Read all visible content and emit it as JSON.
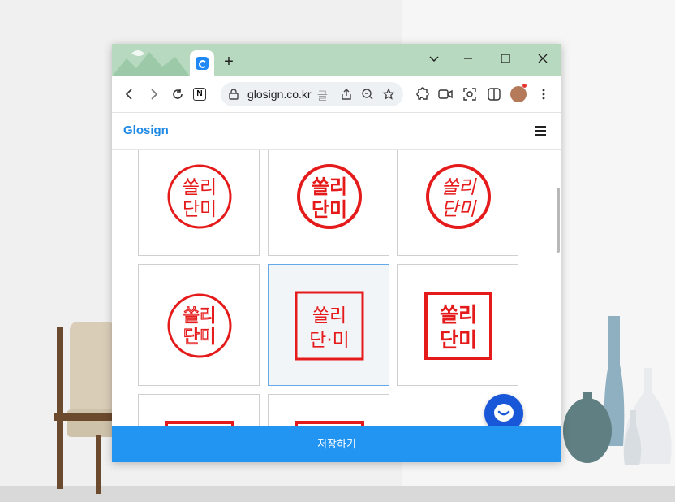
{
  "browser": {
    "url": "glosign.co.kr",
    "url_suffix": "글",
    "tab_favicon": "glosign-icon",
    "new_tab_label": "+",
    "window_controls": [
      "chevron-down-icon",
      "minimize-icon",
      "maximize-icon",
      "close-icon"
    ],
    "toolbar_icons": [
      "back-icon",
      "forward-icon",
      "reload-icon",
      "notion-icon",
      "lock-icon",
      "share-icon",
      "zoom-icon",
      "bookmark-icon",
      "extensions-icon",
      "camera-icon",
      "screenshot-icon",
      "sidebar-icon",
      "profile-avatar",
      "more-icon"
    ],
    "notion_icon_letter": "N"
  },
  "page": {
    "logo": "Glosign",
    "stamp_color": "#e51a1a",
    "stamps": [
      {
        "style": "circle",
        "top": "쏠리",
        "bottom": "단미",
        "selected": false
      },
      {
        "style": "circle-bold",
        "top": "쏠리",
        "bottom": "단미",
        "selected": false
      },
      {
        "style": "circle-brush",
        "top": "쏠리",
        "bottom": "단미",
        "selected": false
      },
      {
        "style": "circle-seal",
        "top": "쏠리",
        "bottom": "단미",
        "selected": false
      },
      {
        "style": "square",
        "top": "쏠리",
        "bottom": "단·미",
        "selected": true
      },
      {
        "style": "square-bold",
        "top": "쏠리",
        "bottom": "단미",
        "selected": false
      },
      {
        "style": "square",
        "top": "",
        "bottom": "",
        "selected": false
      },
      {
        "style": "square",
        "top": "",
        "bottom": "",
        "selected": false
      }
    ],
    "save_button": "저장하기",
    "accent_color": "#2294f2",
    "chat_button_icon": "chat-icon"
  }
}
